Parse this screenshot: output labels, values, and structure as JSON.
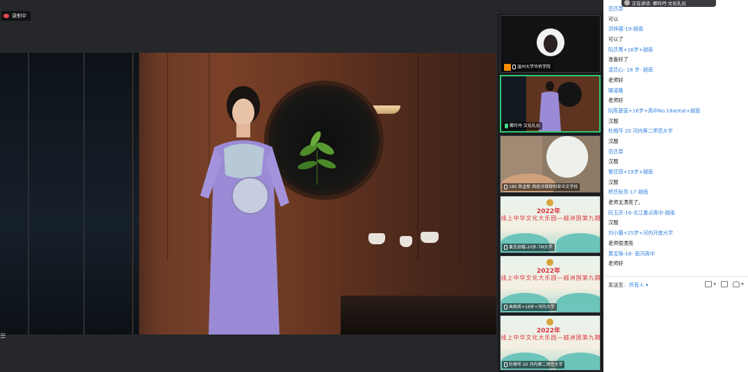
{
  "stage": {
    "recording_label": "录制中",
    "menu_icon": "hamburger-icon"
  },
  "chat": {
    "speaking_label": "正在讲话: 椰玲丹·文化礼仪",
    "messages": [
      {
        "kind": "name",
        "text": "范氏草"
      },
      {
        "kind": "text",
        "text": "可以"
      },
      {
        "kind": "name",
        "text": "洪梓德-19-越南"
      },
      {
        "kind": "text",
        "text": "可以了"
      },
      {
        "kind": "name",
        "text": "阮氏莺+16岁+越南"
      },
      {
        "kind": "text",
        "text": "准备好了"
      },
      {
        "kind": "name",
        "text": "凌氏心- 18 岁- 越南"
      },
      {
        "kind": "text",
        "text": "老师好"
      },
      {
        "kind": "name",
        "text": "陳道隆"
      },
      {
        "kind": "text",
        "text": "老师好"
      },
      {
        "kind": "name",
        "text": "阮陈楚蓝+16岁+高中No.18atXat+越南"
      },
      {
        "kind": "text",
        "text": "汉服"
      },
      {
        "kind": "name",
        "text": "杜梅芩 20 河内第二师范大学"
      },
      {
        "kind": "text",
        "text": "汉服"
      },
      {
        "kind": "name",
        "text": "范氏草"
      },
      {
        "kind": "text",
        "text": "汉服"
      },
      {
        "kind": "name",
        "text": "黎氏琼+19岁+越南"
      },
      {
        "kind": "text",
        "text": "汉服"
      },
      {
        "kind": "name",
        "text": "桥氏秋芳-17-越南"
      },
      {
        "kind": "text",
        "text": "老师太漂亮了。"
      },
      {
        "kind": "name",
        "text": "阮玉庆-16-北江重点高中-越南"
      },
      {
        "kind": "text",
        "text": "汉服"
      },
      {
        "kind": "name",
        "text": "刘小猫+25岁+河内开放大学"
      },
      {
        "kind": "text",
        "text": "老师很漂亮"
      },
      {
        "kind": "name",
        "text": "黄宝珠-18- 南河高中"
      },
      {
        "kind": "text",
        "text": "老师好"
      }
    ],
    "send_to_label": "发送至:",
    "send_to_value": "所有人",
    "send_to_caret": "▾"
  },
  "thumbnails": [
    {
      "label": "温州大学华侨学院",
      "host": true,
      "active": false,
      "kind": "camera"
    },
    {
      "label": "椰玲丹·文化礼仪",
      "host": false,
      "active": true,
      "kind": "speaker"
    },
    {
      "label": "180 陈金新 西班牙穆穆利亚中文学校",
      "host": false,
      "active": false,
      "kind": "blur"
    },
    {
      "label": "黄氏琼娥-20岁-TM大学",
      "host": false,
      "active": false,
      "kind": "poster"
    },
    {
      "label": "高梅英+18岁+河内大学",
      "host": false,
      "active": false,
      "kind": "poster"
    },
    {
      "label": "杜梅芩 20 河内第二师范大学",
      "host": false,
      "active": false,
      "kind": "poster"
    }
  ],
  "poster": {
    "year": "2022年",
    "slogan": "线上中华文化大乐园—越洲国第九期"
  },
  "colors": {
    "accent": "#2f7fde",
    "active_border": "#2ecc71",
    "record_dot": "#e9494a",
    "host_badge": "#ff8a00"
  }
}
